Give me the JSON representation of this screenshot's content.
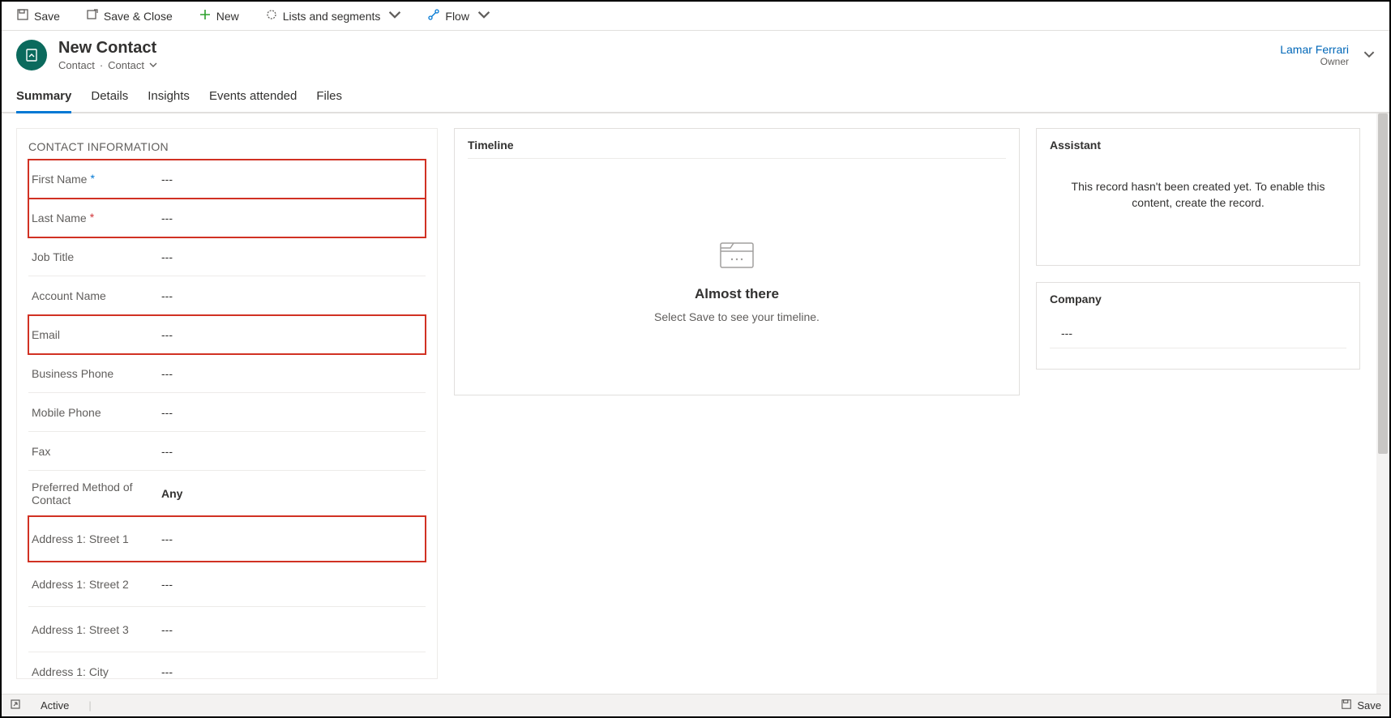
{
  "commands": {
    "save": "Save",
    "save_close": "Save & Close",
    "new": "New",
    "lists": "Lists and segments",
    "flow": "Flow"
  },
  "header": {
    "title": "New Contact",
    "entity": "Contact",
    "form": "Contact",
    "owner_name": "Lamar Ferrari",
    "owner_label": "Owner"
  },
  "tabs": [
    "Summary",
    "Details",
    "Insights",
    "Events attended",
    "Files"
  ],
  "section": {
    "title": "CONTACT INFORMATION",
    "fields": [
      {
        "label": "First Name",
        "value": "---",
        "required": "blue",
        "hl": true
      },
      {
        "label": "Last Name",
        "value": "---",
        "required": "red",
        "hl": true
      },
      {
        "label": "Job Title",
        "value": "---"
      },
      {
        "label": "Account Name",
        "value": "---"
      },
      {
        "label": "Email",
        "value": "---",
        "hl": true
      },
      {
        "label": "Business Phone",
        "value": "---"
      },
      {
        "label": "Mobile Phone",
        "value": "---"
      },
      {
        "label": "Fax",
        "value": "---"
      },
      {
        "label": "Preferred Method of Contact",
        "value": "Any",
        "bold": true
      },
      {
        "label": "Address 1: Street 1",
        "value": "---",
        "hl": true
      },
      {
        "label": "Address 1: Street 2",
        "value": "---"
      },
      {
        "label": "Address 1: Street 3",
        "value": "---"
      },
      {
        "label": "Address 1: City",
        "value": "---"
      }
    ]
  },
  "timeline": {
    "title": "Timeline",
    "heading": "Almost there",
    "sub": "Select Save to see your timeline."
  },
  "assistant": {
    "title": "Assistant",
    "message": "This record hasn't been created yet. To enable this content, create the record."
  },
  "company_card": {
    "title": "Company",
    "value": "---"
  },
  "footer": {
    "status": "Active",
    "save": "Save"
  }
}
